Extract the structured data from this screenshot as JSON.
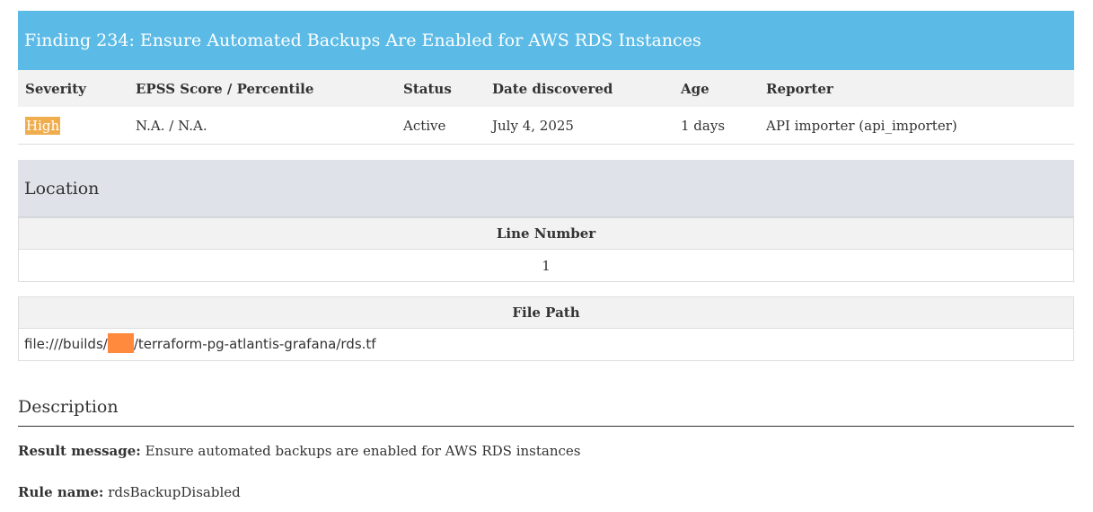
{
  "finding": {
    "title": "Finding 234: Ensure Automated Backups Are Enabled for AWS RDS Instances"
  },
  "summary": {
    "headers": {
      "severity": "Severity",
      "epss": "EPSS Score / Percentile",
      "status": "Status",
      "date_discovered": "Date discovered",
      "age": "Age",
      "reporter": "Reporter"
    },
    "row": {
      "severity": "High",
      "epss": "N.A. / N.A.",
      "status": "Active",
      "date_discovered": "July 4, 2025",
      "age": "1 days",
      "reporter": "API importer (api_importer)"
    }
  },
  "location": {
    "heading": "Location",
    "line_number_header": "Line Number",
    "line_number": "1",
    "file_path_header": "File Path",
    "file_path_prefix": "file:///builds/",
    "file_path_suffix": "/terraform-pg-atlantis-grafana/rds.tf"
  },
  "description": {
    "heading": "Description",
    "result_message_label": "Result message:",
    "result_message": "Ensure automated backups are enabled for AWS RDS instances",
    "rule_name_label": "Rule name:",
    "rule_name": "rdsBackupDisabled"
  },
  "colors": {
    "header_bg": "#5bbbe6",
    "severity_high": "#f0ad4e",
    "location_bg": "#dfe2e8",
    "redaction": "#ff8a3d"
  }
}
